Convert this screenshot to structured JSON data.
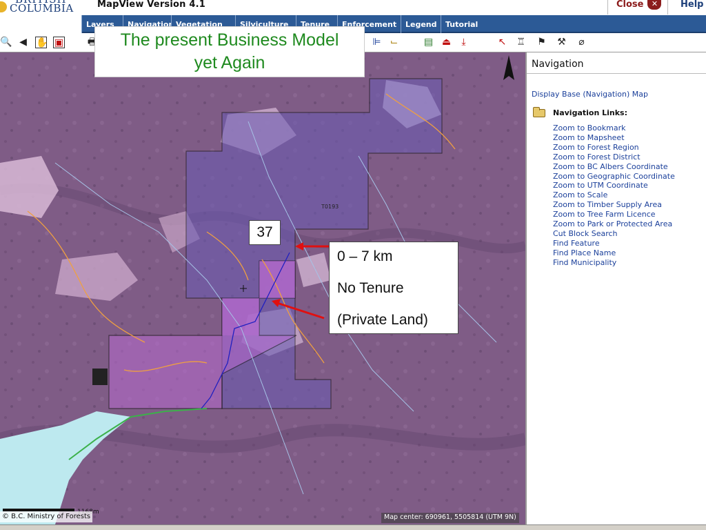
{
  "header": {
    "logo_line1": "BRITISH",
    "logo_line2": "COLUMBIA",
    "app_title": "MapView Version 4.1",
    "close_label": "Close",
    "help_label": "Help"
  },
  "tabs": [
    {
      "label": "Layers"
    },
    {
      "label": "Navigation"
    },
    {
      "label": "Vegetation"
    },
    {
      "label": "Silviculture"
    },
    {
      "label": "Tenure"
    },
    {
      "label": "Enforcement"
    },
    {
      "label": "Legend"
    },
    {
      "label": "Tutorial"
    }
  ],
  "toolbar": {
    "icons": [
      "zoom-icon",
      "back-icon",
      "pan-hand-icon",
      "full-extent-icon",
      "print-icon",
      "grid-icon",
      "ruler-icon",
      "export-map-icon",
      "save-icon",
      "download-icon",
      "pointer-icon",
      "select-icon",
      "measure-icon",
      "tool-icon",
      "eraser-icon"
    ]
  },
  "overlay": {
    "title_line1": "The present Business Model",
    "title_line2": "yet Again",
    "badge": "37",
    "info_line1": "0 – 7 km",
    "info_line2": "No Tenure",
    "info_line3": "(Private Land)"
  },
  "map": {
    "label_t0193": "T0193",
    "credit": "© B.C. Ministry of Forests",
    "scale_label": "1168m",
    "center_text": "Map center: 690961, 5505814 (UTM 9N)"
  },
  "panel": {
    "title": "Navigation",
    "base_link": "Display Base (Navigation) Map",
    "links_heading": "Navigation Links:",
    "links": [
      "Zoom to Bookmark",
      "Zoom to Mapsheet",
      "Zoom to Forest Region",
      "Zoom to Forest District",
      "Zoom to BC Albers Coordinate",
      "Zoom to Geographic Coordinate",
      "Zoom to UTM Coordinate",
      "Zoom to Scale",
      "Zoom to Timber Supply Area",
      "Zoom to Tree Farm Licence",
      "Zoom to Park or Protected Area",
      "Cut Block Search",
      "Find Feature",
      "Find Place Name",
      "Find Municipality"
    ]
  },
  "colors": {
    "tabbar": "#2c5a96",
    "link": "#1a3f9a",
    "title_green": "#1f8a1f",
    "arrow_red": "#e01010",
    "map_base": "#7f5c86"
  }
}
